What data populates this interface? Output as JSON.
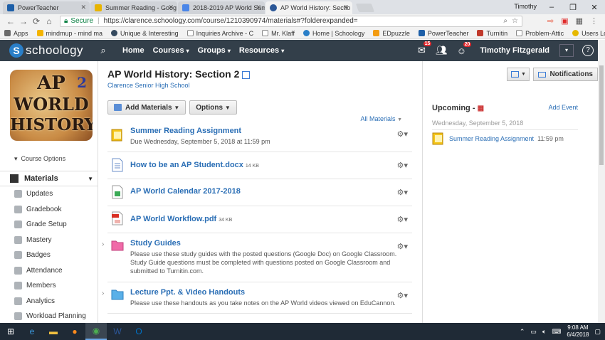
{
  "browser": {
    "tabs": [
      {
        "title": "PowerTeacher",
        "color": "#1d5fa8"
      },
      {
        "title": "Summer Reading - Goog",
        "color": "#e8b400"
      },
      {
        "title": "2018-2019 AP World Sum",
        "color": "#4a86e8"
      },
      {
        "title": "AP World History: Sectio",
        "color": "#2b5797"
      }
    ],
    "profile_name": "Timothy",
    "secure_label": "Secure",
    "url": "https://clarence.schoology.com/course/1210390974/materials#?folderexpanded=",
    "bookmarks": [
      {
        "label": "Apps",
        "color": "#6b6b6b"
      },
      {
        "label": "mindmup - mind ma",
        "color": "#f4b400"
      },
      {
        "label": "Unique & Interesting",
        "color": "#34495e"
      },
      {
        "label": "Inquiries Archive - C",
        "color": "#888888"
      },
      {
        "label": "Mr. Klaff",
        "color": "#999999"
      },
      {
        "label": "Home | Schoology",
        "color": "#2a7fc8"
      },
      {
        "label": "EDpuzzle",
        "color": "#f39c12"
      },
      {
        "label": "PowerTeacher",
        "color": "#1d5fa8"
      },
      {
        "label": "Turnitin",
        "color": "#c0392b"
      },
      {
        "label": "Problem-Attic",
        "color": "#888888"
      },
      {
        "label": "Users Login Page -",
        "color": "#e6b800"
      }
    ]
  },
  "nav": {
    "logo": "schoology",
    "links": [
      "Home",
      "Courses",
      "Groups",
      "Resources"
    ],
    "badges": {
      "messages": "15",
      "notifications": "20"
    },
    "username": "Timothy Fitzgerald"
  },
  "sidebar": {
    "image_text": {
      "line1": "AP",
      "line2": "WORLD",
      "line3": "HISTORY",
      "num": "2"
    },
    "course_options": "Course Options",
    "section_header": "Materials",
    "items": [
      "Updates",
      "Gradebook",
      "Grade Setup",
      "Mastery",
      "Badges",
      "Attendance",
      "Members",
      "Analytics",
      "Workload Planning"
    ]
  },
  "main": {
    "title": "AP World History: Section 2",
    "school": "Clarence Senior High School",
    "add_materials": "Add Materials",
    "options": "Options",
    "all_materials": "All Materials",
    "materials": [
      {
        "type": "assignment",
        "title": "Summer Reading Assignment",
        "size": "",
        "sub": "Due Wednesday, September 5, 2018 at 11:59 pm"
      },
      {
        "type": "doc",
        "title": "How to be an AP Student.docx",
        "size": "14 KB",
        "sub": ""
      },
      {
        "type": "sheet",
        "title": "AP World Calendar 2017-2018",
        "size": "",
        "sub": ""
      },
      {
        "type": "pdf",
        "title": "AP World Workflow.pdf",
        "size": "34 KB",
        "sub": ""
      },
      {
        "type": "folder-pink",
        "title": "Study Guides",
        "size": "",
        "sub": "Please use these study guides with the posted questions (Google Doc) on Google Classroom. Study Guide questions must be completed with questions posted on Google Classroom and submitted to Turnitin.com."
      },
      {
        "type": "folder-blue",
        "title": "Lecture Ppt. & Video Handouts",
        "size": "",
        "sub": "Please use these handouts as you take notes on the AP World videos viewed on EduCannon."
      }
    ]
  },
  "right": {
    "notifications": "Notifications",
    "upcoming": "Upcoming",
    "add_event": "Add Event",
    "date": "Wednesday, September 5, 2018",
    "item_title": "Summer Reading Assignment",
    "item_time": "11:59 pm"
  },
  "taskbar": {
    "time": "9:08 AM",
    "date": "6/4/2018"
  }
}
